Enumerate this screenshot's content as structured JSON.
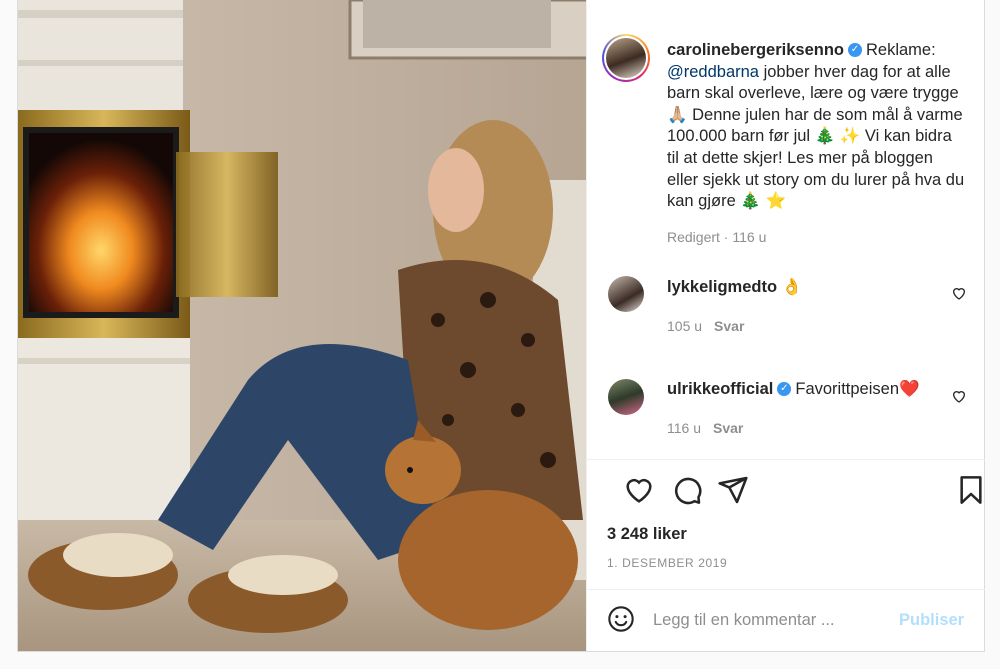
{
  "post": {
    "author": "carolinebergeriksenno",
    "caption_prefix": "Reklame:",
    "mention": "@reddbarna",
    "caption_body": "jobber hver dag for at alle barn skal overleve, lære og være trygge 🙏🏼 Denne julen har de som mål å varme 100.000 barn før jul 🎄 ✨ Vi kan bidra til at dette skjer! Les mer på bloggen eller sjekk ut story om du lurer på hva du kan gjøre 🎄 ⭐️",
    "caption_meta": "Redigert · 116 u",
    "likes": "3 248 liker",
    "date": "1. DESEMBER 2019"
  },
  "comments": [
    {
      "user": "lykkeligmedto",
      "text": "👌",
      "time": "105 u",
      "reply": "Svar",
      "verified": false
    },
    {
      "user": "ulrikkeofficial",
      "text": "Favorittpeisen❤️",
      "time": "116 u",
      "reply": "Svar",
      "verified": true
    }
  ],
  "composer": {
    "placeholder": "Legg til en kommentar ...",
    "publish_label": "Publiser"
  },
  "icons": {
    "like": "heart-icon",
    "comment": "comment-icon",
    "share": "paper-plane-icon",
    "save": "bookmark-icon",
    "emoji": "smiley-icon",
    "verified": "verified-badge-icon"
  },
  "colors": {
    "link": "#00376b",
    "verified": "#3897f0",
    "muted": "#8e8e8e",
    "publish_disabled": "#b2dffc"
  }
}
